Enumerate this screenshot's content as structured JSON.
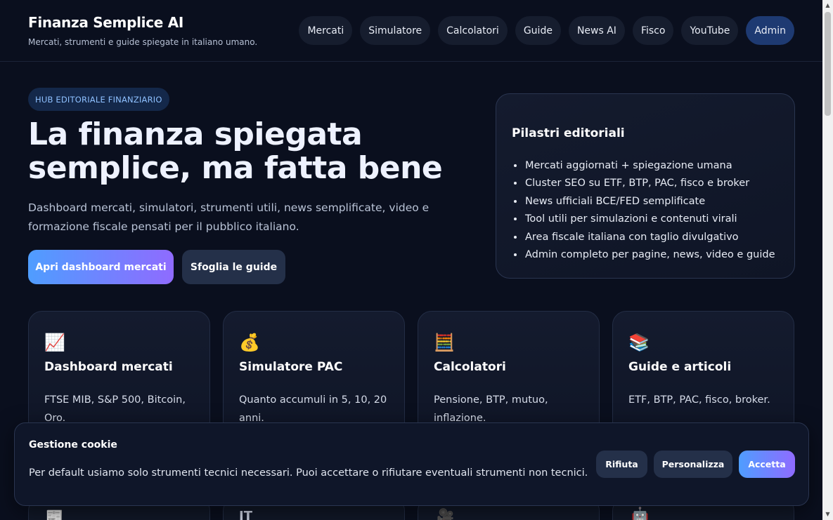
{
  "header": {
    "title": "Finanza Semplice AI",
    "subtitle": "Mercati, strumenti e guide spiegate in italiano umano.",
    "nav": [
      "Mercati",
      "Simulatore",
      "Calcolatori",
      "Guide",
      "News AI",
      "Fisco",
      "YouTube",
      "Admin"
    ]
  },
  "hero": {
    "badge": "HUB EDITORIALE FINANZIARIO",
    "title_line1": "La finanza spiegata",
    "title_line2": "semplice, ma fatta bene",
    "description": "Dashboard mercati, simulatori, strumenti utili, news semplificate, video e formazione fiscale pensati per il pubblico italiano.",
    "primary_cta": "Apri dashboard mercati",
    "secondary_cta": "Sfoglia le guide"
  },
  "pillars": {
    "title": "Pilastri editoriali",
    "items": [
      "Mercati aggiornati + spiegazione umana",
      "Cluster SEO su ETF, BTP, PAC, fisco e broker",
      "News ufficiali BCE/FED semplificate",
      "Tool utili per simulazioni e contenuti virali",
      "Area fiscale italiana con taglio divulgativo",
      "Admin completo per pagine, news, video e guide"
    ]
  },
  "cards": [
    {
      "icon": "chart-up-icon",
      "emoji": "📈",
      "title": "Dashboard mercati",
      "text": "FTSE MIB, S&P 500, Bitcoin, Oro."
    },
    {
      "icon": "money-bag-icon",
      "emoji": "💰",
      "title": "Simulatore PAC",
      "text": "Quanto accumuli in 5, 10, 20 anni."
    },
    {
      "icon": "abacus-icon",
      "emoji": "🧮",
      "title": "Calcolatori",
      "text": "Pensione, BTP, mutuo, inflazione."
    },
    {
      "icon": "books-icon",
      "emoji": "📚",
      "title": "Guide e articoli",
      "text": "ETF, BTP, PAC, fisco, broker."
    }
  ],
  "second_row_icons": [
    {
      "icon": "newspaper-icon",
      "emoji": "📰"
    },
    {
      "icon": "it-text-icon",
      "text": "IT"
    },
    {
      "icon": "camera-icon",
      "emoji": "🎥"
    },
    {
      "icon": "robot-icon",
      "emoji": "🤖"
    }
  ],
  "cookie": {
    "title": "Gestione cookie",
    "text": "Per default usiamo solo strumenti tecnici necessari. Puoi accettare o rifiutare eventuali strumenti non tecnici.",
    "reject": "Rifiuta",
    "customize": "Personalizza",
    "accept": "Accetta"
  },
  "colors": {
    "background": "#0a0f1e",
    "accent_gradient_start": "#4f9dff",
    "accent_gradient_end": "#8f6bff",
    "admin_nav": "#1e3a72"
  }
}
